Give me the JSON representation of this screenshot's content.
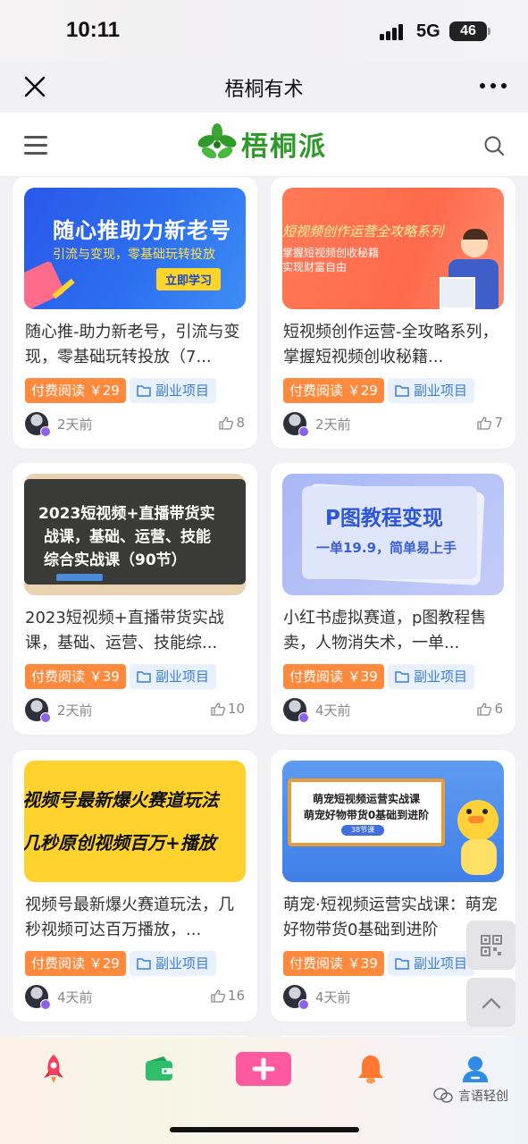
{
  "status": {
    "time": "10:11",
    "network": "5G",
    "battery": "46"
  },
  "nav": {
    "title": "梧桐有术"
  },
  "site": {
    "logo_text": "梧桐派"
  },
  "cards": [
    {
      "thumb_title": "随心推助力新老号",
      "thumb_sub": "引流与变现，零基础玩转投放",
      "thumb_btn": "立即学习",
      "title": "随心推-助力新老号，引流与变现，零基础玩转投放（7...",
      "price": "付费阅读 ￥29",
      "category": "副业项目",
      "time": "2天前",
      "likes": "8"
    },
    {
      "thumb_title": "短视频创作运营全攻略系列",
      "thumb_sub": "掌握短视频创收秘籍",
      "thumb_sub2": "实现财富自由",
      "title": "短视频创作运营-全攻略系列，掌握短视频创收秘籍...",
      "price": "付费阅读 ￥29",
      "category": "副业项目",
      "time": "2天前",
      "likes": "7"
    },
    {
      "thumb_line1": "2023短视频+直播带货实",
      "thumb_line2": "战课，基础、运营、技能",
      "thumb_line3": "综合实战课（90节）",
      "title": "2023短视频+直播带货实战课，基础、运营、技能综...",
      "price": "付费阅读 ￥39",
      "category": "副业项目",
      "time": "2天前",
      "likes": "10"
    },
    {
      "thumb_title": "P图教程变现",
      "thumb_sub": "一单19.9，简单易上手",
      "title": "小红书虚拟赛道，p图教程售卖，人物消失术，一单...",
      "price": "付费阅读 ￥39",
      "category": "副业项目",
      "time": "4天前",
      "likes": "6"
    },
    {
      "thumb_line1": "视频号最新爆火赛道玩法",
      "thumb_line2": "几秒原创视频百万+播放",
      "title": "视频号最新爆火赛道玩法，几秒视频可达百万播放，...",
      "price": "付费阅读 ￥29",
      "category": "副业项目",
      "time": "4天前",
      "likes": "16"
    },
    {
      "thumb_line1": "萌宠短视频运营实战课",
      "thumb_line2": "萌宠好物带货0基础到进阶",
      "thumb_pill": "38节课",
      "title": "萌宠·短视频运营实战课：萌宠好物带货0基础到进阶",
      "price": "付费阅读 ￥39",
      "category": "副业项目",
      "time": "4天前",
      "likes": ""
    }
  ],
  "tabs": [
    {
      "icon": "rocket-icon",
      "color": "#f0405a"
    },
    {
      "icon": "wallet-icon",
      "color": "#2fbf6a"
    },
    {
      "icon": "plus-icon",
      "color": "#ff5aa0"
    },
    {
      "icon": "bell-icon",
      "color": "#ff7a30"
    },
    {
      "icon": "user-icon",
      "color": "#2f8be8"
    }
  ],
  "watermark": "言语轻创"
}
